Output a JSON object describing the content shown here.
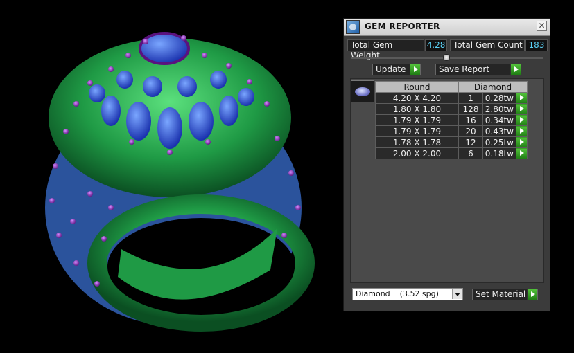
{
  "panel": {
    "title": "GEM REPORTER",
    "close_symbol": "✕",
    "total_weight_label": "Total Gem Weight",
    "total_weight_value": "4.28",
    "total_count_label": "Total Gem Count",
    "total_count_value": "183",
    "update_label": "Update",
    "save_report_label": "Save Report",
    "table": {
      "headers": [
        "Round",
        "Diamond"
      ],
      "rows": [
        {
          "size": "4.20 X 4.20",
          "count": "1",
          "weight": "0.28tw"
        },
        {
          "size": "1.80 X 1.80",
          "count": "128",
          "weight": "2.80tw"
        },
        {
          "size": "1.79 X 1.79",
          "count": "16",
          "weight": "0.34tw"
        },
        {
          "size": "1.79 X 1.79",
          "count": "20",
          "weight": "0.43tw"
        },
        {
          "size": "1.78 X 1.78",
          "count": "12",
          "weight": "0.25tw"
        },
        {
          "size": "2.00 X 2.00",
          "count": "6",
          "weight": "0.18tw"
        }
      ]
    },
    "material_value": "Diamond    (3.52 spg)",
    "set_material_label": "Set Material"
  },
  "icons": {
    "title": "gem-reporter-app-icon",
    "row_action": "play-arrow-icon",
    "gem": "round-gem-thumbnail"
  },
  "colors": {
    "metal": "#2fae55",
    "gem_blue": "#2a4bd6",
    "prong_purple": "#8a2bb8",
    "value_text": "#5ad1f5",
    "go_button": "#3aa52a"
  }
}
